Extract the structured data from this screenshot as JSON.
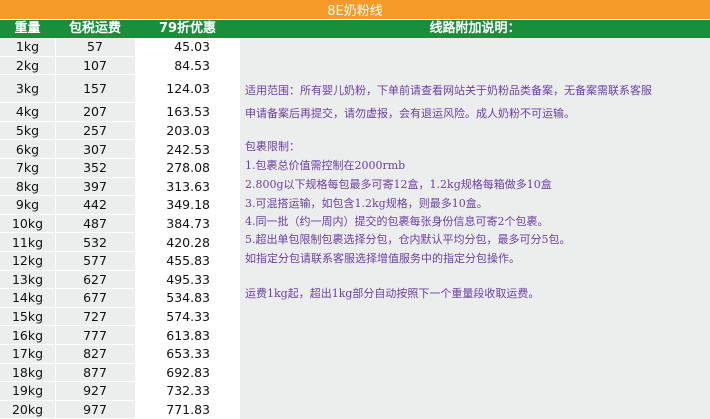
{
  "title": "8E奶粉线",
  "headers": {
    "weight": "重量",
    "tax_freight": "包税运费",
    "discount": "79折优惠",
    "notes": "线路附加说明："
  },
  "rows": [
    {
      "weight": "1kg",
      "freight": "57",
      "discount": "45.03"
    },
    {
      "weight": "2kg",
      "freight": "107",
      "discount": "84.53"
    },
    {
      "weight": "3kg",
      "freight": "157",
      "discount": "124.03"
    },
    {
      "weight": "4kg",
      "freight": "207",
      "discount": "163.53"
    },
    {
      "weight": "5kg",
      "freight": "257",
      "discount": "203.03"
    },
    {
      "weight": "6kg",
      "freight": "307",
      "discount": "242.53"
    },
    {
      "weight": "7kg",
      "freight": "352",
      "discount": "278.08"
    },
    {
      "weight": "8kg",
      "freight": "397",
      "discount": "313.63"
    },
    {
      "weight": "9kg",
      "freight": "442",
      "discount": "349.18"
    },
    {
      "weight": "10kg",
      "freight": "487",
      "discount": "384.73"
    },
    {
      "weight": "11kg",
      "freight": "532",
      "discount": "420.28"
    },
    {
      "weight": "12kg",
      "freight": "577",
      "discount": "455.83"
    },
    {
      "weight": "13kg",
      "freight": "627",
      "discount": "495.33"
    },
    {
      "weight": "14kg",
      "freight": "677",
      "discount": "534.83"
    },
    {
      "weight": "15kg",
      "freight": "727",
      "discount": "574.33"
    },
    {
      "weight": "16kg",
      "freight": "777",
      "discount": "613.83"
    },
    {
      "weight": "17kg",
      "freight": "827",
      "discount": "653.33"
    },
    {
      "weight": "18kg",
      "freight": "877",
      "discount": "692.83"
    },
    {
      "weight": "19kg",
      "freight": "927",
      "discount": "732.33"
    },
    {
      "weight": "20kg",
      "freight": "977",
      "discount": "771.83"
    }
  ],
  "notes": {
    "scope_1": "适用范围：所有婴儿奶粉，下单前请查看网站关于奶粉品类备案，无备案需联系客服",
    "scope_2": "申请备案后再提交，请勿虚报，会有退运风险。成人奶粉不可运输。",
    "limits_title": "包裹限制：",
    "limit_1": "1.包裹总价值需控制在2000rmb",
    "limit_2": "2.800g以下规格每包最多可寄12盒，1.2kg规格每箱做多10盒",
    "limit_3": "3.可混搭运输，如包含1.2kg规格，则最多10盒。",
    "limit_4": "4.同一批（约一周内）提交的包裹每张身份信息可寄2个包裹。",
    "limit_5": "5.超出单包限制包裹选择分包，仓内默认平均分包，最多可分5包。",
    "split_note": "如指定分包请联系客服选择增值服务中的指定分包操作。",
    "freight_rule": "运费1kg起，超出1kg部分自动按照下一个重量段收取运费。"
  },
  "colors": {
    "title_bg": "#f59a27",
    "header_bg": "#198f3c",
    "notes_text": "#6b3fa6"
  }
}
